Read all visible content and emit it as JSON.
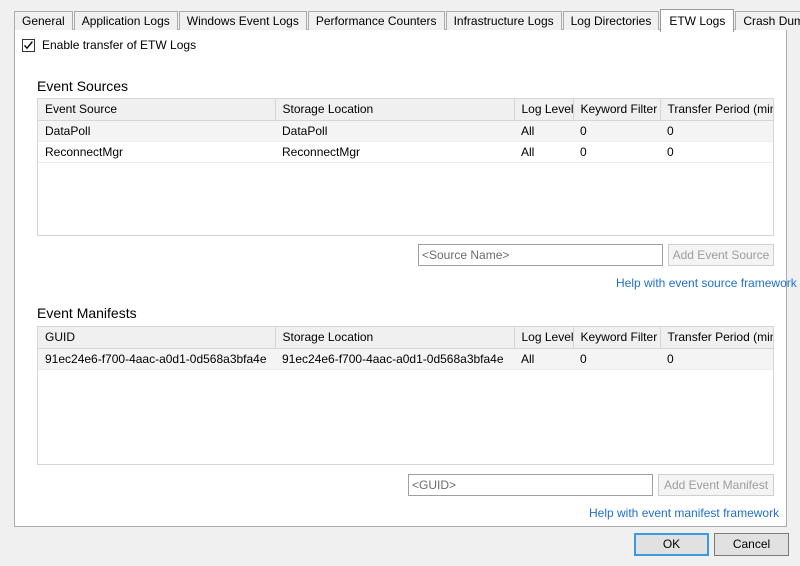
{
  "tabs": [
    {
      "label": "General",
      "active": false
    },
    {
      "label": "Application Logs",
      "active": false
    },
    {
      "label": "Windows Event Logs",
      "active": false
    },
    {
      "label": "Performance Counters",
      "active": false
    },
    {
      "label": "Infrastructure Logs",
      "active": false
    },
    {
      "label": "Log Directories",
      "active": false
    },
    {
      "label": "ETW Logs",
      "active": true
    },
    {
      "label": "Crash Dumps",
      "active": false
    }
  ],
  "enable": {
    "label": "Enable transfer of ETW Logs",
    "checked": true
  },
  "event_sources": {
    "title": "Event Sources",
    "columns": [
      "Event Source",
      "Storage Location",
      "Log Level",
      "Keyword Filter",
      "Transfer Period (min)"
    ],
    "rows": [
      [
        "DataPoll",
        "DataPoll",
        "All",
        "0",
        "0"
      ],
      [
        "ReconnectMgr",
        "ReconnectMgr",
        "All",
        "0",
        "0"
      ]
    ],
    "input_placeholder": "<Source Name>",
    "input_value": "",
    "add_button": "Add Event Source",
    "add_button_enabled": false,
    "help_link": "Help with event source framework"
  },
  "event_manifests": {
    "title": "Event Manifests",
    "columns": [
      "GUID",
      "Storage Location",
      "Log Level",
      "Keyword Filter",
      "Transfer Period (min)"
    ],
    "rows": [
      [
        "91ec24e6-f700-4aac-a0d1-0d568a3bfa4e",
        "91ec24e6-f700-4aac-a0d1-0d568a3bfa4e",
        "All",
        "0",
        "0"
      ]
    ],
    "input_placeholder": "<GUID>",
    "input_value": "",
    "add_button": "Add Event Manifest",
    "add_button_enabled": false,
    "help_link": "Help with event manifest framework"
  },
  "footer": {
    "ok": "OK",
    "cancel": "Cancel"
  },
  "colors": {
    "link": "#1f6fd0",
    "accent": "#3c99e0",
    "panel_bg": "#ffffff",
    "dialog_bg": "#f0f0f0",
    "header_bg": "#f0f0f0",
    "alt_row_bg": "#f4f4f4"
  }
}
